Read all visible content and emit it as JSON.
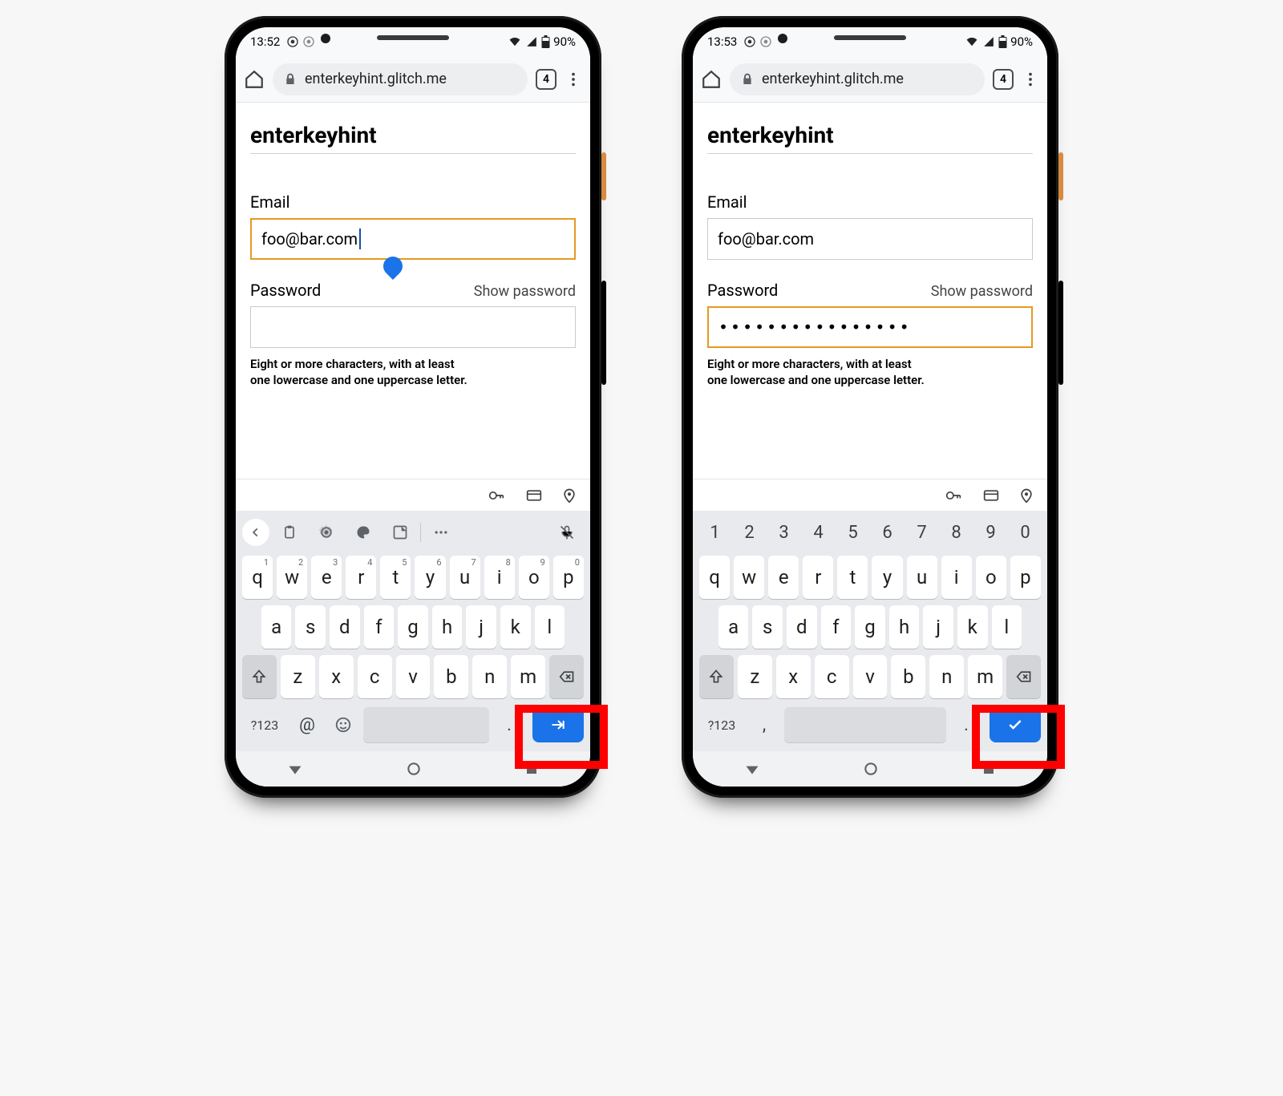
{
  "phones": {
    "left": {
      "status": {
        "time": "13:52",
        "battery": "90%"
      },
      "chrome": {
        "url": "enterkeyhint.glitch.me",
        "tab_count": "4"
      },
      "page": {
        "title": "enterkeyhint",
        "email_label": "Email",
        "email_value": "foo@bar.com",
        "password_label": "Password",
        "show_password": "Show password",
        "password_value": "",
        "hint_line1": "Eight or more characters, with at least",
        "hint_line2": "one lowercase and one uppercase letter."
      },
      "keyboard": {
        "row1": [
          {
            "k": "q",
            "s": "1"
          },
          {
            "k": "w",
            "s": "2"
          },
          {
            "k": "e",
            "s": "3"
          },
          {
            "k": "r",
            "s": "4"
          },
          {
            "k": "t",
            "s": "5"
          },
          {
            "k": "y",
            "s": "6"
          },
          {
            "k": "u",
            "s": "7"
          },
          {
            "k": "i",
            "s": "8"
          },
          {
            "k": "o",
            "s": "9"
          },
          {
            "k": "p",
            "s": "0"
          }
        ],
        "row2": [
          "a",
          "s",
          "d",
          "f",
          "g",
          "h",
          "j",
          "k",
          "l"
        ],
        "row3": [
          "z",
          "x",
          "c",
          "v",
          "b",
          "n",
          "m"
        ],
        "sym": "?123",
        "extra1": "@",
        "extra2": "."
      }
    },
    "right": {
      "status": {
        "time": "13:53",
        "battery": "90%"
      },
      "chrome": {
        "url": "enterkeyhint.glitch.me",
        "tab_count": "4"
      },
      "page": {
        "title": "enterkeyhint",
        "email_label": "Email",
        "email_value": "foo@bar.com",
        "password_label": "Password",
        "show_password": "Show password",
        "password_value": "••••••••••••••••",
        "hint_line1": "Eight or more characters, with at least",
        "hint_line2": "one lowercase and one uppercase letter."
      },
      "keyboard": {
        "number_row": [
          "1",
          "2",
          "3",
          "4",
          "5",
          "6",
          "7",
          "8",
          "9",
          "0"
        ],
        "row1": [
          {
            "k": "q"
          },
          {
            "k": "w"
          },
          {
            "k": "e"
          },
          {
            "k": "r"
          },
          {
            "k": "t"
          },
          {
            "k": "y"
          },
          {
            "k": "u"
          },
          {
            "k": "i"
          },
          {
            "k": "o"
          },
          {
            "k": "p"
          }
        ],
        "row2": [
          "a",
          "s",
          "d",
          "f",
          "g",
          "h",
          "j",
          "k",
          "l"
        ],
        "row3": [
          "z",
          "x",
          "c",
          "v",
          "b",
          "n",
          "m"
        ],
        "sym": "?123",
        "extra1": ",",
        "extra2": "."
      }
    }
  }
}
